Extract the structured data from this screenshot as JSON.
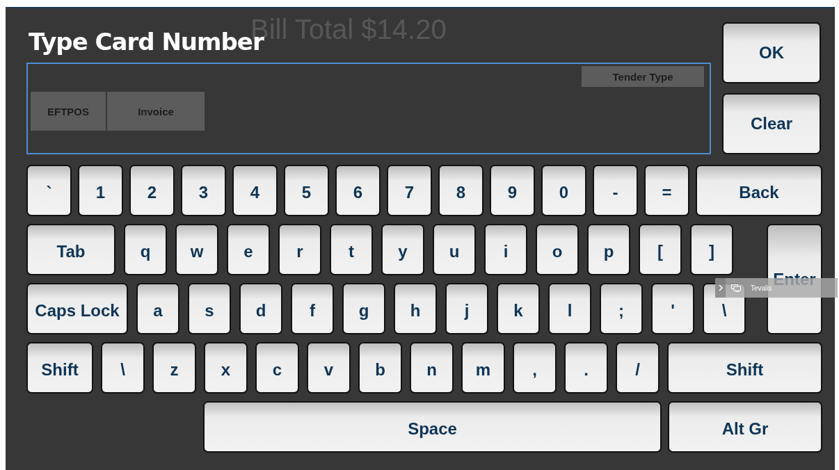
{
  "backdrop": {
    "bill_total": "Bill Total $14.20",
    "tender_buttons": [
      "EFTPOS",
      "Invoice"
    ],
    "table_columns": [
      "Tender Type"
    ]
  },
  "dialog": {
    "title": "Type Card Number",
    "buttons": [
      "OK",
      "Clear"
    ]
  },
  "keyboard": {
    "rows": [
      [
        {
          "label": "`",
          "kind": "char"
        },
        {
          "label": "1",
          "kind": "char"
        },
        {
          "label": "2",
          "kind": "char"
        },
        {
          "label": "3",
          "kind": "char"
        },
        {
          "label": "4",
          "kind": "char"
        },
        {
          "label": "5",
          "kind": "char"
        },
        {
          "label": "6",
          "kind": "char"
        },
        {
          "label": "7",
          "kind": "char"
        },
        {
          "label": "8",
          "kind": "char"
        },
        {
          "label": "9",
          "kind": "char"
        },
        {
          "label": "0",
          "kind": "char"
        },
        {
          "label": "-",
          "kind": "char"
        },
        {
          "label": "=",
          "kind": "char"
        },
        {
          "label": "Back",
          "kind": "fill"
        }
      ],
      [
        {
          "label": "Tab",
          "kind": "tab"
        },
        {
          "label": "q",
          "kind": "char"
        },
        {
          "label": "w",
          "kind": "char"
        },
        {
          "label": "e",
          "kind": "char"
        },
        {
          "label": "r",
          "kind": "char"
        },
        {
          "label": "t",
          "kind": "char"
        },
        {
          "label": "y",
          "kind": "char"
        },
        {
          "label": "u",
          "kind": "char"
        },
        {
          "label": "i",
          "kind": "char"
        },
        {
          "label": "o",
          "kind": "char"
        },
        {
          "label": "p",
          "kind": "char"
        },
        {
          "label": "[",
          "kind": "char"
        },
        {
          "label": "]",
          "kind": "char"
        },
        {
          "label": "Enter",
          "kind": "enter"
        }
      ],
      [
        {
          "label": "Caps Lock",
          "kind": "caps"
        },
        {
          "label": "a",
          "kind": "char"
        },
        {
          "label": "s",
          "kind": "char"
        },
        {
          "label": "d",
          "kind": "char"
        },
        {
          "label": "f",
          "kind": "char"
        },
        {
          "label": "g",
          "kind": "char"
        },
        {
          "label": "h",
          "kind": "char"
        },
        {
          "label": "j",
          "kind": "char"
        },
        {
          "label": "k",
          "kind": "char"
        },
        {
          "label": "l",
          "kind": "char"
        },
        {
          "label": ";",
          "kind": "char"
        },
        {
          "label": "'",
          "kind": "char"
        },
        {
          "label": "\\",
          "kind": "char"
        }
      ],
      [
        {
          "label": "Shift",
          "kind": "shift"
        },
        {
          "label": "\\",
          "kind": "char"
        },
        {
          "label": "z",
          "kind": "char"
        },
        {
          "label": "x",
          "kind": "char"
        },
        {
          "label": "c",
          "kind": "char"
        },
        {
          "label": "v",
          "kind": "char"
        },
        {
          "label": "b",
          "kind": "char"
        },
        {
          "label": "n",
          "kind": "char"
        },
        {
          "label": "m",
          "kind": "char"
        },
        {
          "label": ",",
          "kind": "char"
        },
        {
          "label": ".",
          "kind": "char"
        },
        {
          "label": "/",
          "kind": "char"
        },
        {
          "label": "Shift",
          "kind": "fill"
        }
      ],
      [
        {
          "label": "Space",
          "kind": "space"
        },
        {
          "label": "Alt Gr",
          "kind": "altgr"
        }
      ]
    ]
  },
  "tooltip": {
    "label": "Tevalis"
  }
}
